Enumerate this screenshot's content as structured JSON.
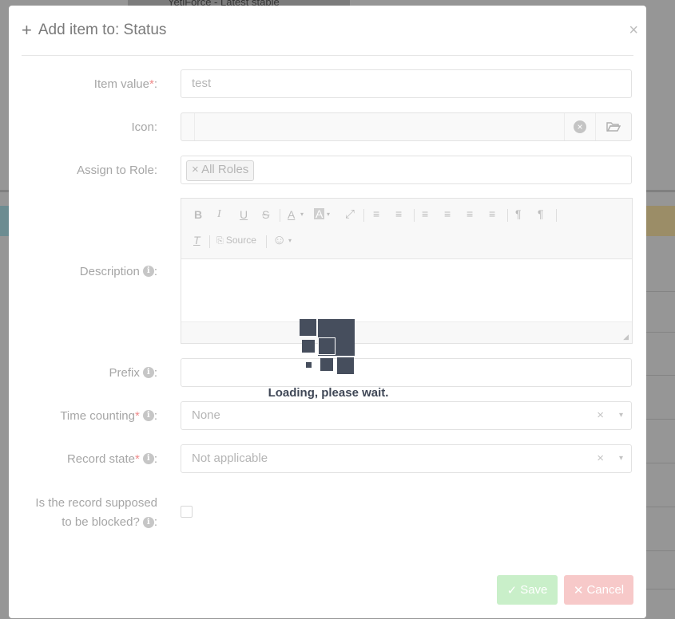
{
  "background": {
    "tab_title": "YetiForce - Latest stable"
  },
  "modal": {
    "title": "Add item to: Status",
    "plus_symbol": "+",
    "close_symbol": "×",
    "fields": {
      "item_value": {
        "label": "Item value",
        "required": "*",
        "suffix": ":",
        "value": "test"
      },
      "icon": {
        "label": "Icon:",
        "value": "",
        "clear_icon": "×",
        "folder_icon": "folder-open-icon"
      },
      "assign_to_role": {
        "label": "Assign to Role:",
        "tag": "× All Roles"
      },
      "description": {
        "label": "Description",
        "suffix": ":",
        "info": "i"
      },
      "prefix": {
        "label": "Prefix",
        "suffix": ":",
        "value": ""
      },
      "time_counting": {
        "label": "Time counting",
        "required": "*",
        "suffix": ":",
        "value": "None",
        "clear": "×",
        "arrow": "▾"
      },
      "record_state": {
        "label": "Record state",
        "required": "*",
        "suffix": ":",
        "value": "Not applicable",
        "clear": "×",
        "arrow": "▾"
      },
      "is_blocked": {
        "label_line1": "Is the record supposed",
        "label_line2": "to be blocked?",
        "suffix": ":"
      }
    },
    "editor_toolbar": {
      "bold": "B",
      "italic": "I",
      "underline": "U",
      "strike": "S",
      "text_color": "A",
      "bg_color": "A",
      "maximize": "⤢",
      "numbered_list": "≡",
      "bullet_list": "≡",
      "align_left": "≡",
      "align_center": "≡",
      "align_right": "≡",
      "justify": "≡",
      "ltr": "¶",
      "rtl": "¶",
      "remove_format": "T",
      "source_label": "Source",
      "emoji": "☺"
    },
    "buttons": {
      "save": "Save",
      "save_icon": "✓",
      "cancel": "Cancel",
      "cancel_icon": "✕"
    }
  },
  "loader": {
    "text": "Loading, please wait."
  },
  "colors": {
    "loader": "#464e5d",
    "save_button": "#c9efc9",
    "cancel_button": "#f7c9c9"
  }
}
